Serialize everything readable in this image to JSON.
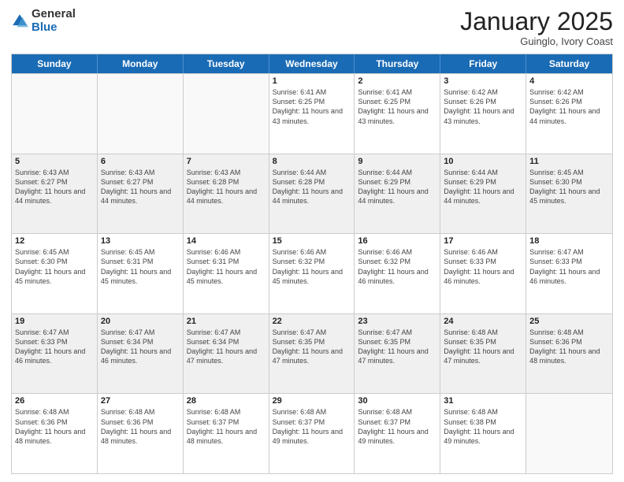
{
  "logo": {
    "general": "General",
    "blue": "Blue"
  },
  "header": {
    "month": "January 2025",
    "location": "Guinglo, Ivory Coast"
  },
  "days_of_week": [
    "Sunday",
    "Monday",
    "Tuesday",
    "Wednesday",
    "Thursday",
    "Friday",
    "Saturday"
  ],
  "weeks": [
    [
      {
        "day": "",
        "sunrise": "",
        "sunset": "",
        "daylight": "",
        "empty": true
      },
      {
        "day": "",
        "sunrise": "",
        "sunset": "",
        "daylight": "",
        "empty": true
      },
      {
        "day": "",
        "sunrise": "",
        "sunset": "",
        "daylight": "",
        "empty": true
      },
      {
        "day": "1",
        "sunrise": "Sunrise: 6:41 AM",
        "sunset": "Sunset: 6:25 PM",
        "daylight": "Daylight: 11 hours and 43 minutes.",
        "empty": false
      },
      {
        "day": "2",
        "sunrise": "Sunrise: 6:41 AM",
        "sunset": "Sunset: 6:25 PM",
        "daylight": "Daylight: 11 hours and 43 minutes.",
        "empty": false
      },
      {
        "day": "3",
        "sunrise": "Sunrise: 6:42 AM",
        "sunset": "Sunset: 6:26 PM",
        "daylight": "Daylight: 11 hours and 43 minutes.",
        "empty": false
      },
      {
        "day": "4",
        "sunrise": "Sunrise: 6:42 AM",
        "sunset": "Sunset: 6:26 PM",
        "daylight": "Daylight: 11 hours and 44 minutes.",
        "empty": false
      }
    ],
    [
      {
        "day": "5",
        "sunrise": "Sunrise: 6:43 AM",
        "sunset": "Sunset: 6:27 PM",
        "daylight": "Daylight: 11 hours and 44 minutes.",
        "empty": false
      },
      {
        "day": "6",
        "sunrise": "Sunrise: 6:43 AM",
        "sunset": "Sunset: 6:27 PM",
        "daylight": "Daylight: 11 hours and 44 minutes.",
        "empty": false
      },
      {
        "day": "7",
        "sunrise": "Sunrise: 6:43 AM",
        "sunset": "Sunset: 6:28 PM",
        "daylight": "Daylight: 11 hours and 44 minutes.",
        "empty": false
      },
      {
        "day": "8",
        "sunrise": "Sunrise: 6:44 AM",
        "sunset": "Sunset: 6:28 PM",
        "daylight": "Daylight: 11 hours and 44 minutes.",
        "empty": false
      },
      {
        "day": "9",
        "sunrise": "Sunrise: 6:44 AM",
        "sunset": "Sunset: 6:29 PM",
        "daylight": "Daylight: 11 hours and 44 minutes.",
        "empty": false
      },
      {
        "day": "10",
        "sunrise": "Sunrise: 6:44 AM",
        "sunset": "Sunset: 6:29 PM",
        "daylight": "Daylight: 11 hours and 44 minutes.",
        "empty": false
      },
      {
        "day": "11",
        "sunrise": "Sunrise: 6:45 AM",
        "sunset": "Sunset: 6:30 PM",
        "daylight": "Daylight: 11 hours and 45 minutes.",
        "empty": false
      }
    ],
    [
      {
        "day": "12",
        "sunrise": "Sunrise: 6:45 AM",
        "sunset": "Sunset: 6:30 PM",
        "daylight": "Daylight: 11 hours and 45 minutes.",
        "empty": false
      },
      {
        "day": "13",
        "sunrise": "Sunrise: 6:45 AM",
        "sunset": "Sunset: 6:31 PM",
        "daylight": "Daylight: 11 hours and 45 minutes.",
        "empty": false
      },
      {
        "day": "14",
        "sunrise": "Sunrise: 6:46 AM",
        "sunset": "Sunset: 6:31 PM",
        "daylight": "Daylight: 11 hours and 45 minutes.",
        "empty": false
      },
      {
        "day": "15",
        "sunrise": "Sunrise: 6:46 AM",
        "sunset": "Sunset: 6:32 PM",
        "daylight": "Daylight: 11 hours and 45 minutes.",
        "empty": false
      },
      {
        "day": "16",
        "sunrise": "Sunrise: 6:46 AM",
        "sunset": "Sunset: 6:32 PM",
        "daylight": "Daylight: 11 hours and 46 minutes.",
        "empty": false
      },
      {
        "day": "17",
        "sunrise": "Sunrise: 6:46 AM",
        "sunset": "Sunset: 6:33 PM",
        "daylight": "Daylight: 11 hours and 46 minutes.",
        "empty": false
      },
      {
        "day": "18",
        "sunrise": "Sunrise: 6:47 AM",
        "sunset": "Sunset: 6:33 PM",
        "daylight": "Daylight: 11 hours and 46 minutes.",
        "empty": false
      }
    ],
    [
      {
        "day": "19",
        "sunrise": "Sunrise: 6:47 AM",
        "sunset": "Sunset: 6:33 PM",
        "daylight": "Daylight: 11 hours and 46 minutes.",
        "empty": false
      },
      {
        "day": "20",
        "sunrise": "Sunrise: 6:47 AM",
        "sunset": "Sunset: 6:34 PM",
        "daylight": "Daylight: 11 hours and 46 minutes.",
        "empty": false
      },
      {
        "day": "21",
        "sunrise": "Sunrise: 6:47 AM",
        "sunset": "Sunset: 6:34 PM",
        "daylight": "Daylight: 11 hours and 47 minutes.",
        "empty": false
      },
      {
        "day": "22",
        "sunrise": "Sunrise: 6:47 AM",
        "sunset": "Sunset: 6:35 PM",
        "daylight": "Daylight: 11 hours and 47 minutes.",
        "empty": false
      },
      {
        "day": "23",
        "sunrise": "Sunrise: 6:47 AM",
        "sunset": "Sunset: 6:35 PM",
        "daylight": "Daylight: 11 hours and 47 minutes.",
        "empty": false
      },
      {
        "day": "24",
        "sunrise": "Sunrise: 6:48 AM",
        "sunset": "Sunset: 6:35 PM",
        "daylight": "Daylight: 11 hours and 47 minutes.",
        "empty": false
      },
      {
        "day": "25",
        "sunrise": "Sunrise: 6:48 AM",
        "sunset": "Sunset: 6:36 PM",
        "daylight": "Daylight: 11 hours and 48 minutes.",
        "empty": false
      }
    ],
    [
      {
        "day": "26",
        "sunrise": "Sunrise: 6:48 AM",
        "sunset": "Sunset: 6:36 PM",
        "daylight": "Daylight: 11 hours and 48 minutes.",
        "empty": false
      },
      {
        "day": "27",
        "sunrise": "Sunrise: 6:48 AM",
        "sunset": "Sunset: 6:36 PM",
        "daylight": "Daylight: 11 hours and 48 minutes.",
        "empty": false
      },
      {
        "day": "28",
        "sunrise": "Sunrise: 6:48 AM",
        "sunset": "Sunset: 6:37 PM",
        "daylight": "Daylight: 11 hours and 48 minutes.",
        "empty": false
      },
      {
        "day": "29",
        "sunrise": "Sunrise: 6:48 AM",
        "sunset": "Sunset: 6:37 PM",
        "daylight": "Daylight: 11 hours and 49 minutes.",
        "empty": false
      },
      {
        "day": "30",
        "sunrise": "Sunrise: 6:48 AM",
        "sunset": "Sunset: 6:37 PM",
        "daylight": "Daylight: 11 hours and 49 minutes.",
        "empty": false
      },
      {
        "day": "31",
        "sunrise": "Sunrise: 6:48 AM",
        "sunset": "Sunset: 6:38 PM",
        "daylight": "Daylight: 11 hours and 49 minutes.",
        "empty": false
      },
      {
        "day": "",
        "sunrise": "",
        "sunset": "",
        "daylight": "",
        "empty": true
      }
    ]
  ]
}
